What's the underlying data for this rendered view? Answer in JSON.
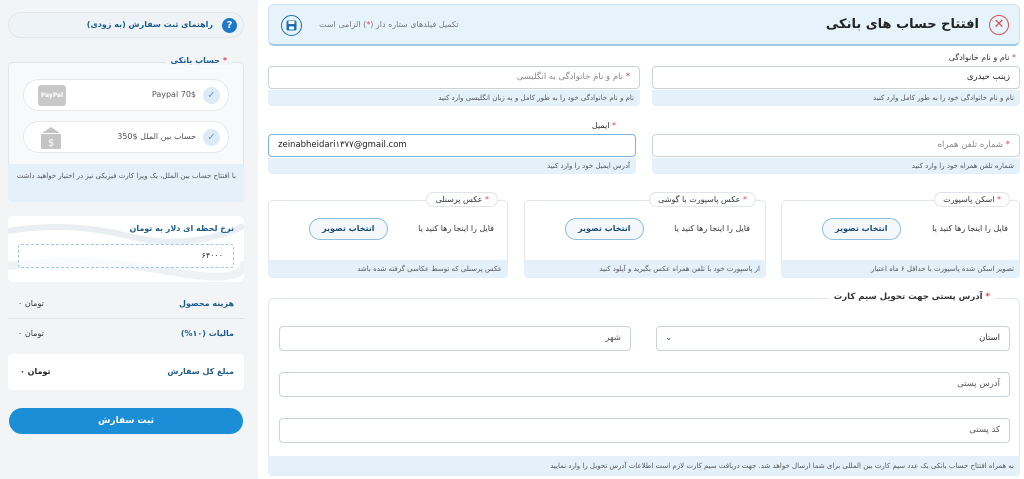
{
  "header": {
    "title": "افتتاح حساب های بانکی",
    "required_note_pre": "تکمیل فیلدهای ستاره دار (",
    "required_note_star": "*",
    "required_note_post": ") الزامی است"
  },
  "form": {
    "name": {
      "label": "نام و نام خانوادگی",
      "value": "زینب حیدری",
      "hint": "نام و نام خانوادگی خود را به طور کامل وارد کنید"
    },
    "name_en": {
      "placeholder": "نام و نام خانوادگی به انگلیسی",
      "hint": "نام و نام خانوادگی خود را به طور کامل و به زبان انگلیسی وارد کنید"
    },
    "phone": {
      "placeholder": "شماره تلفن همراه",
      "hint": "شماره تلفن همراه خود را وارد کنید"
    },
    "email": {
      "label": "ایمیل",
      "value": "zeinabheidari۱۳۷۷@gmail.com",
      "hint": "آدرس ایمیل خود را وارد کنید"
    },
    "uploads": [
      {
        "title": "اسکن پاسپورت",
        "drop_text": "فایل را اینجا رها کنید یا",
        "button": "انتخاب تصویر",
        "hint": "تصویر اسکن شده پاسپورت با حداقل ۶ ماه اعتبار"
      },
      {
        "title": "عکس پاسپورت با گوشی",
        "drop_text": "فایل را اینجا رها کنید یا",
        "button": "انتخاب تصویر",
        "hint": "از پاسپورت خود با تلفن همراه عکس بگیرید و آپلود کنید"
      },
      {
        "title": "عکس پرسنلی",
        "drop_text": "فایل را اینجا رها کنید یا",
        "button": "انتخاب تصویر",
        "hint": "عکس پرسنلی که توسط عکاسی گرفته شده باشد"
      }
    ],
    "address": {
      "title": "آدرس پستی جهت تحویل سیم کارت",
      "province": "استان",
      "city": "شهر",
      "postal_address": "آدرس پستی",
      "postal_code": "کد پستی",
      "hint": "به همراه افتتاح حساب بانکی یک عدد سیم کارت بین المللی برای شما ارسال خواهد شد. جهت دریافت سیم کارت لازم است اطلاعات آدرس تحویل را وارد نمایید"
    }
  },
  "sidebar": {
    "guide": "راهنمای ثبت سفارش (به زودی)",
    "bank_title": "حساب بانکی",
    "options": [
      {
        "label": "Paypal 70$",
        "logo": "PayPal"
      },
      {
        "label": "350$ حساب بین الملل",
        "logo": "bank-icon"
      }
    ],
    "bank_note": "با افتتاح حساب بین الملل، یک ویزا کارت فیزیکی نیز در اختیار خواهید داشت",
    "rate_title": "نرخ لحظه ای دلار به تومان",
    "rate_value": "۶۴۰۰۰",
    "rows": [
      {
        "label": "هزینه محصول",
        "value": "۰ تومان"
      },
      {
        "label": "مالیات (۱۰%)",
        "value": "۰ تومان"
      },
      {
        "label": "مبلغ کل سفارش",
        "value": "۰ تومان"
      }
    ],
    "submit": "ثبت سفارش"
  },
  "colors": {
    "accent": "#1a8fd8",
    "required": "#e04050",
    "header_bg": "#e7f3fb"
  }
}
